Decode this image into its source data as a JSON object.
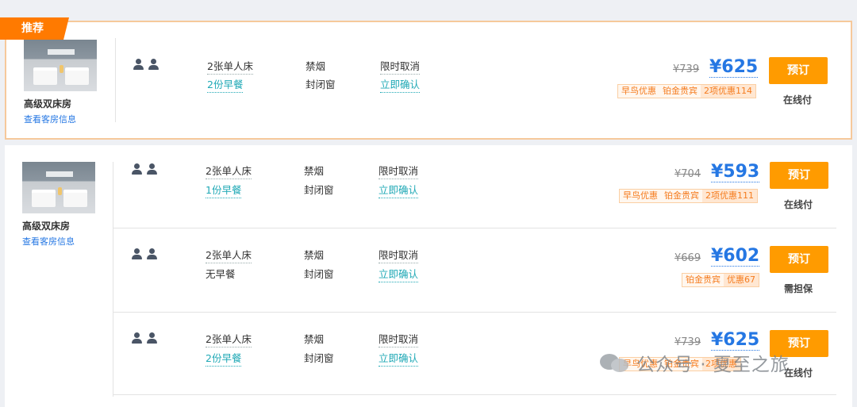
{
  "badge": "推荐",
  "rooms": [
    {
      "name": "高级双床房",
      "link": "查看客房信息"
    },
    {
      "name": "高级双床房",
      "link": "查看客房信息"
    }
  ],
  "offers": [
    {
      "bed": "2张单人床",
      "breakfast": "2份早餐",
      "smoking": "禁烟",
      "window": "封闭窗",
      "cancel": "限时取消",
      "confirm": "立即确认",
      "old_price": "¥739",
      "price": "¥625",
      "tags": [
        "早鸟优惠",
        "铂金贵宾",
        "2项优惠114"
      ],
      "button": "预订",
      "payment": "在线付"
    },
    {
      "bed": "2张单人床",
      "breakfast": "1份早餐",
      "smoking": "禁烟",
      "window": "封闭窗",
      "cancel": "限时取消",
      "confirm": "立即确认",
      "old_price": "¥704",
      "price": "¥593",
      "tags": [
        "早鸟优惠",
        "铂金贵宾",
        "2项优惠111"
      ],
      "button": "预订",
      "payment": "在线付"
    },
    {
      "bed": "2张单人床",
      "breakfast": "无早餐",
      "smoking": "禁烟",
      "window": "封闭窗",
      "cancel": "限时取消",
      "confirm": "立即确认",
      "old_price": "¥669",
      "price": "¥602",
      "tags": [
        "铂金贵宾",
        "优惠67"
      ],
      "button": "预订",
      "payment": "需担保"
    },
    {
      "bed": "2张单人床",
      "breakfast": "2份早餐",
      "smoking": "禁烟",
      "window": "封闭窗",
      "cancel": "限时取消",
      "confirm": "立即确认",
      "old_price": "¥739",
      "price": "¥625",
      "tags": [
        "早鸟优惠",
        "铂金贵宾",
        "2项优惠"
      ],
      "button": "预订",
      "payment": "在线付"
    }
  ],
  "watermark": "公众号 · 夏至之旅",
  "colors": {
    "accent": "#ff9b00",
    "price": "#2577e3",
    "link_teal": "#20a9b6",
    "badge": "#ff7a00"
  }
}
